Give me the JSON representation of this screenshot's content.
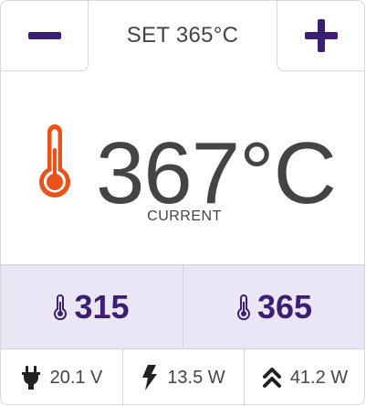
{
  "header": {
    "set_label": "SET 365°C",
    "decrease_icon": "minus-icon",
    "increase_icon": "plus-icon",
    "accent_color": "#3c1e73"
  },
  "current": {
    "value": "367°C",
    "label": "CURRENT",
    "icon": "thermometer-icon",
    "icon_color": "#e8531c"
  },
  "temps": [
    {
      "icon": "thermometer-small-icon",
      "value": "315"
    },
    {
      "icon": "thermometer-small-icon",
      "value": "365"
    }
  ],
  "stats": [
    {
      "icon": "plug-icon",
      "value": "20.1 V"
    },
    {
      "icon": "bolt-icon",
      "value": "13.5 W"
    },
    {
      "icon": "double-chevron-up-icon",
      "value": "41.2 W"
    }
  ]
}
